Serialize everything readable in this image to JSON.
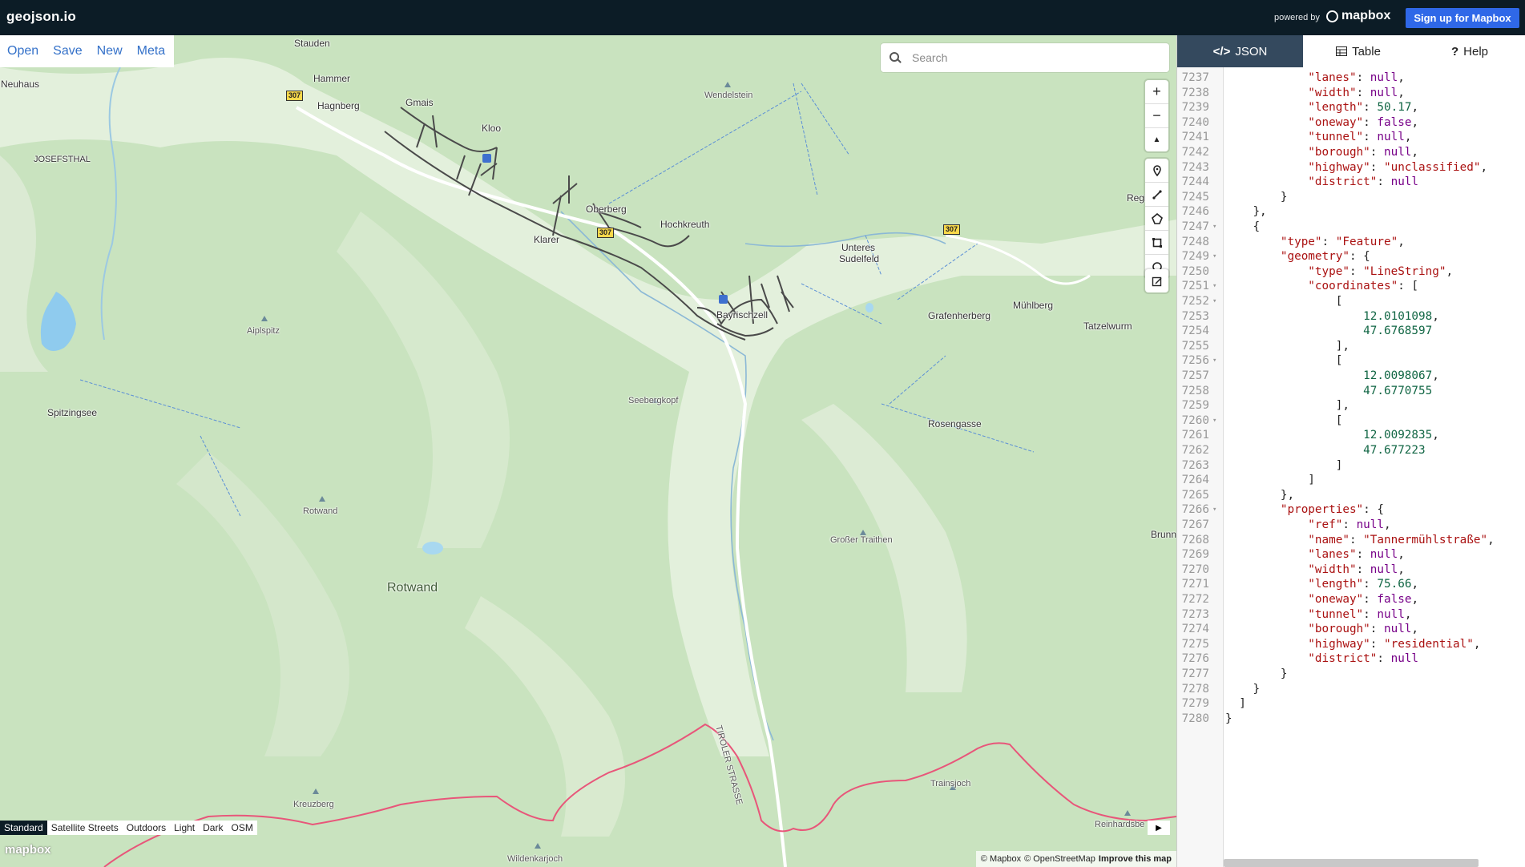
{
  "app": {
    "title": "geojson.io"
  },
  "header": {
    "powered_by": "powered by",
    "mapbox_logo": "mapbox",
    "signup_label": "Sign up for Mapbox"
  },
  "file_menu": {
    "open": "Open",
    "save": "Save",
    "new": "New",
    "meta": "Meta"
  },
  "search": {
    "placeholder": "Search"
  },
  "map_controls": {
    "zoom_in": "+",
    "zoom_out": "−",
    "compass": "▲",
    "draw_tools": [
      "marker-icon",
      "line-icon",
      "polygon-icon",
      "rectangle-icon",
      "circle-icon"
    ],
    "edit": "edit-icon"
  },
  "map_labels": [
    {
      "id": "stauden",
      "text": "Stauden"
    },
    {
      "id": "neuhaus",
      "text": "Neuhaus"
    },
    {
      "id": "hammer",
      "text": "Hammer"
    },
    {
      "id": "hagnberg",
      "text": "Hagnberg"
    },
    {
      "id": "gmais",
      "text": "Gmais"
    },
    {
      "id": "kloo",
      "text": "Kloo"
    },
    {
      "id": "josefsthal",
      "text": "JOSEFSTHAL"
    },
    {
      "id": "wendelstein",
      "text": "Wendelstein"
    },
    {
      "id": "oberberg",
      "text": "Oberberg"
    },
    {
      "id": "hochkreuth",
      "text": "Hochkreuth"
    },
    {
      "id": "klarer",
      "text": "Klarer"
    },
    {
      "id": "regi",
      "text": "Regi"
    },
    {
      "id": "unteres",
      "text": "Unteres"
    },
    {
      "id": "sudelfeld",
      "text": "Sudelfeld"
    },
    {
      "id": "bayrischzell",
      "text": "Bayrischzell"
    },
    {
      "id": "grafenherberg",
      "text": "Grafenherberg"
    },
    {
      "id": "muehlberg",
      "text": "Mühlberg"
    },
    {
      "id": "tatzelwurm",
      "text": "Tatzelwurm"
    },
    {
      "id": "aiplspitz",
      "text": "Aiplspitz"
    },
    {
      "id": "spitzingsee",
      "text": "Spitzingsee"
    },
    {
      "id": "seebergkopf",
      "text": "Seebergkopf"
    },
    {
      "id": "rosengasse",
      "text": "Rosengasse"
    },
    {
      "id": "rotwand_peak",
      "text": "Rotwand"
    },
    {
      "id": "grosser_traithen",
      "text": "Großer Traithen"
    },
    {
      "id": "brunn",
      "text": "Brunn"
    },
    {
      "id": "rotwand_area",
      "text": "Rotwand"
    },
    {
      "id": "tiroler",
      "text": "TIROLER STRASSE"
    },
    {
      "id": "kreuzberg",
      "text": "Kreuzberg"
    },
    {
      "id": "trainsjoch",
      "text": "Trainsjoch"
    },
    {
      "id": "reinhardsberg",
      "text": "Reinhardsbe"
    },
    {
      "id": "wildenkarjoch",
      "text": "Wildenkarjoch"
    }
  ],
  "road_shield": "307",
  "map_styles": {
    "items": [
      "Standard",
      "Satellite Streets",
      "Outdoors",
      "Light",
      "Dark",
      "OSM"
    ],
    "active": "Standard"
  },
  "map_footer": {
    "wordmark": "mapbox",
    "attribution_1": "© Mapbox",
    "attribution_2": "© OpenStreetMap",
    "improve": "Improve this map"
  },
  "panel_tabs": [
    {
      "label": "JSON",
      "icon": "code-icon",
      "active": true
    },
    {
      "label": "Table",
      "icon": "table-icon",
      "active": false
    },
    {
      "label": "Help",
      "icon": "question-icon",
      "active": false
    }
  ],
  "code_lines": [
    {
      "n": "7237",
      "fold": "",
      "indent": 12,
      "key": "lanes",
      "val": "null",
      "vt": "kw",
      "tail": ","
    },
    {
      "n": "7238",
      "fold": "",
      "indent": 12,
      "key": "width",
      "val": "null",
      "vt": "kw",
      "tail": ","
    },
    {
      "n": "7239",
      "fold": "",
      "indent": 12,
      "key": "length",
      "val": "50.17",
      "vt": "n",
      "tail": ","
    },
    {
      "n": "7240",
      "fold": "",
      "indent": 12,
      "key": "oneway",
      "val": "false",
      "vt": "kw",
      "tail": ","
    },
    {
      "n": "7241",
      "fold": "",
      "indent": 12,
      "key": "tunnel",
      "val": "null",
      "vt": "kw",
      "tail": ","
    },
    {
      "n": "7242",
      "fold": "",
      "indent": 12,
      "key": "borough",
      "val": "null",
      "vt": "kw",
      "tail": ","
    },
    {
      "n": "7243",
      "fold": "",
      "indent": 12,
      "key": "highway",
      "val": "\"unclassified\"",
      "vt": "s",
      "tail": ","
    },
    {
      "n": "7244",
      "fold": "",
      "indent": 12,
      "key": "district",
      "val": "null",
      "vt": "kw",
      "tail": ""
    },
    {
      "n": "7245",
      "fold": "",
      "indent": 8,
      "raw": "}"
    },
    {
      "n": "7246",
      "fold": "",
      "indent": 4,
      "raw": "},"
    },
    {
      "n": "7247",
      "fold": "▾",
      "indent": 4,
      "raw": "{"
    },
    {
      "n": "7248",
      "fold": "",
      "indent": 8,
      "key": "type",
      "val": "\"Feature\"",
      "vt": "s",
      "tail": ","
    },
    {
      "n": "7249",
      "fold": "▾",
      "indent": 8,
      "key": "geometry",
      "val": "{",
      "vt": "",
      "tail": ""
    },
    {
      "n": "7250",
      "fold": "",
      "indent": 12,
      "key": "type",
      "val": "\"LineString\"",
      "vt": "s",
      "tail": ","
    },
    {
      "n": "7251",
      "fold": "▾",
      "indent": 12,
      "key": "coordinates",
      "val": "[",
      "vt": "",
      "tail": ""
    },
    {
      "n": "7252",
      "fold": "▾",
      "indent": 16,
      "raw": "["
    },
    {
      "n": "7253",
      "fold": "",
      "indent": 20,
      "num": "12.0101098",
      "tail": ","
    },
    {
      "n": "7254",
      "fold": "",
      "indent": 20,
      "num": "47.6768597",
      "tail": ""
    },
    {
      "n": "7255",
      "fold": "",
      "indent": 16,
      "raw": "],"
    },
    {
      "n": "7256",
      "fold": "▾",
      "indent": 16,
      "raw": "["
    },
    {
      "n": "7257",
      "fold": "",
      "indent": 20,
      "num": "12.0098067",
      "tail": ","
    },
    {
      "n": "7258",
      "fold": "",
      "indent": 20,
      "num": "47.6770755",
      "tail": ""
    },
    {
      "n": "7259",
      "fold": "",
      "indent": 16,
      "raw": "],"
    },
    {
      "n": "7260",
      "fold": "▾",
      "indent": 16,
      "raw": "["
    },
    {
      "n": "7261",
      "fold": "",
      "indent": 20,
      "num": "12.0092835",
      "tail": ","
    },
    {
      "n": "7262",
      "fold": "",
      "indent": 20,
      "num": "47.677223",
      "tail": ""
    },
    {
      "n": "7263",
      "fold": "",
      "indent": 16,
      "raw": "]"
    },
    {
      "n": "7264",
      "fold": "",
      "indent": 12,
      "raw": "]"
    },
    {
      "n": "7265",
      "fold": "",
      "indent": 8,
      "raw": "},"
    },
    {
      "n": "7266",
      "fold": "▾",
      "indent": 8,
      "key": "properties",
      "val": "{",
      "vt": "",
      "tail": ""
    },
    {
      "n": "7267",
      "fold": "",
      "indent": 12,
      "key": "ref",
      "val": "null",
      "vt": "kw",
      "tail": ","
    },
    {
      "n": "7268",
      "fold": "",
      "indent": 12,
      "key": "name",
      "val": "\"Tannermühlstraße\"",
      "vt": "s",
      "tail": ","
    },
    {
      "n": "7269",
      "fold": "",
      "indent": 12,
      "key": "lanes",
      "val": "null",
      "vt": "kw",
      "tail": ","
    },
    {
      "n": "7270",
      "fold": "",
      "indent": 12,
      "key": "width",
      "val": "null",
      "vt": "kw",
      "tail": ","
    },
    {
      "n": "7271",
      "fold": "",
      "indent": 12,
      "key": "length",
      "val": "75.66",
      "vt": "n",
      "tail": ","
    },
    {
      "n": "7272",
      "fold": "",
      "indent": 12,
      "key": "oneway",
      "val": "false",
      "vt": "kw",
      "tail": ","
    },
    {
      "n": "7273",
      "fold": "",
      "indent": 12,
      "key": "tunnel",
      "val": "null",
      "vt": "kw",
      "tail": ","
    },
    {
      "n": "7274",
      "fold": "",
      "indent": 12,
      "key": "borough",
      "val": "null",
      "vt": "kw",
      "tail": ","
    },
    {
      "n": "7275",
      "fold": "",
      "indent": 12,
      "key": "highway",
      "val": "\"residential\"",
      "vt": "s",
      "tail": ","
    },
    {
      "n": "7276",
      "fold": "",
      "indent": 12,
      "key": "district",
      "val": "null",
      "vt": "kw",
      "tail": ""
    },
    {
      "n": "7277",
      "fold": "",
      "indent": 8,
      "raw": "}"
    },
    {
      "n": "7278",
      "fold": "",
      "indent": 4,
      "raw": "}"
    },
    {
      "n": "7279",
      "fold": "",
      "indent": 2,
      "raw": "]"
    },
    {
      "n": "7280",
      "fold": "",
      "indent": 0,
      "raw": "}"
    }
  ],
  "colors": {
    "topbar": "#0c1c26",
    "signup": "#2f68e8",
    "tab_active": "#34495e",
    "link": "#3471c9",
    "map_forest": "#c9e3bf",
    "border_line": "#e8567a",
    "feature_line": "#444444"
  }
}
